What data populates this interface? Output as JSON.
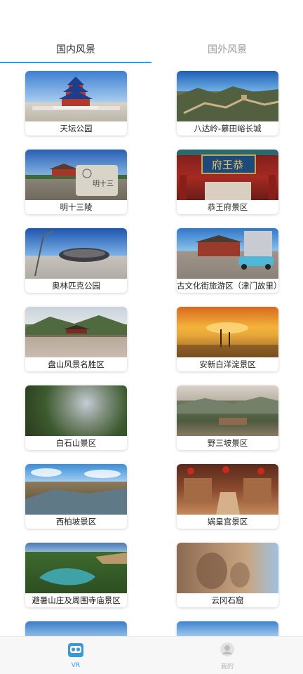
{
  "tabs": [
    {
      "label": "国内风景",
      "active": true
    },
    {
      "label": "国外风景",
      "active": false
    }
  ],
  "places": [
    {
      "name": "天坛公园",
      "thumb": "temple-of-heaven"
    },
    {
      "name": "八达岭-慕田峪长城",
      "thumb": "great-wall"
    },
    {
      "name": "明十三陵",
      "thumb": "ming-tombs"
    },
    {
      "name": "恭王府景区",
      "thumb": "prince-gong-mansion"
    },
    {
      "name": "奥林匹克公园",
      "thumb": "olympic-park"
    },
    {
      "name": "古文化街旅游区（津门故里）",
      "thumb": "ancient-culture-street"
    },
    {
      "name": "盘山风景名胜区",
      "thumb": "panshan"
    },
    {
      "name": "安新白洋淀景区",
      "thumb": "baiyangdian"
    },
    {
      "name": "白石山景区",
      "thumb": "baishishan"
    },
    {
      "name": "野三坡景区",
      "thumb": "yesanpo"
    },
    {
      "name": "西柏坡景区",
      "thumb": "xibaipo"
    },
    {
      "name": "娲皇宫景区",
      "thumb": "wahuanggong"
    },
    {
      "name": "避暑山庄及周围寺庙景区",
      "thumb": "chengde-mountain-resort"
    },
    {
      "name": "云冈石窟",
      "thumb": "yungang-grottoes"
    },
    {
      "name": "",
      "thumb": "partial-landscape"
    },
    {
      "name": "",
      "thumb": "partial-landscape"
    }
  ],
  "nav": [
    {
      "label": "VR",
      "icon": "vr-headset-icon",
      "active": true
    },
    {
      "label": "我的",
      "icon": "user-avatar-icon",
      "active": false
    }
  ],
  "colors": {
    "accent": "#3a9ad9",
    "inactive": "#9a9a9a"
  }
}
